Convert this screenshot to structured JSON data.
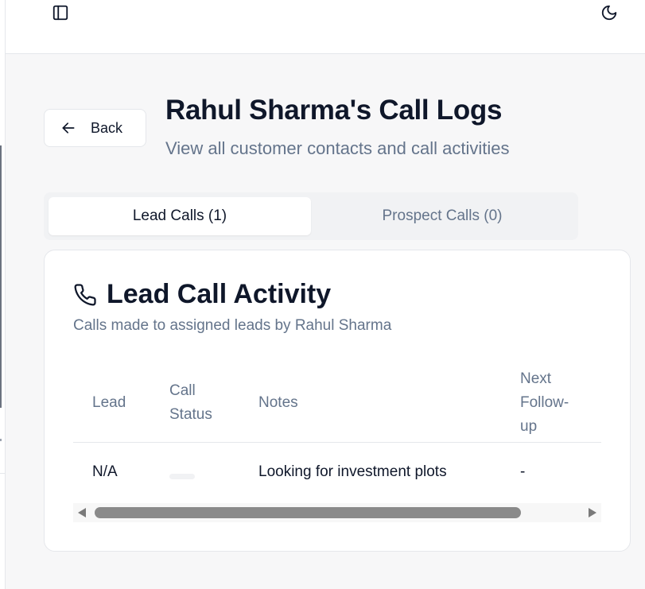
{
  "header": {
    "sidebar_toggle_icon": "panel-left-icon",
    "theme_toggle_icon": "moon-icon"
  },
  "back": {
    "label": "Back",
    "icon": "arrow-left-icon"
  },
  "page": {
    "title": "Rahul Sharma's Call Logs",
    "subtitle": "View all customer contacts and call activities"
  },
  "tabs": [
    {
      "label": "Lead Calls (1)",
      "active": true
    },
    {
      "label": "Prospect Calls (0)",
      "active": false
    }
  ],
  "card": {
    "icon": "phone-icon",
    "title": "Lead Call Activity",
    "description": "Calls made to assigned leads by Rahul Sharma"
  },
  "table": {
    "columns": [
      "Lead",
      "Call Status",
      "Notes",
      "Next Follow-up"
    ],
    "rows": [
      {
        "lead": "N/A",
        "call_status": "",
        "notes": "Looking for investment plots",
        "next_follow_up": "-"
      }
    ]
  },
  "colors": {
    "text_primary": "#0f172a",
    "text_muted": "#64748b",
    "border": "#e5e7eb",
    "tab_bg": "#f1f2f4"
  }
}
